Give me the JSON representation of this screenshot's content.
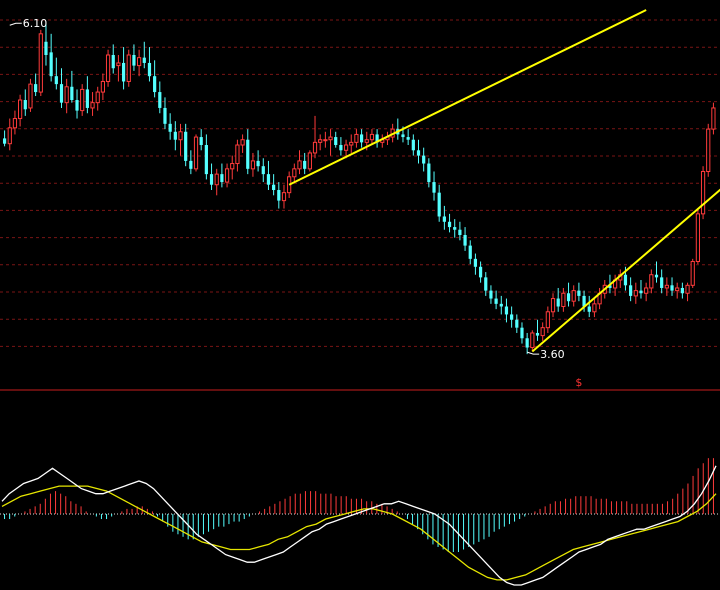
{
  "chart_data": [
    {
      "type": "candlestick",
      "ylim": [
        3.45,
        6.2
      ],
      "annotations": [
        {
          "text": "6.10",
          "index": 1,
          "value": 6.1
        },
        {
          "text": "3.60",
          "index": 101,
          "value": 3.6
        },
        {
          "text": "$",
          "index": 111,
          "value": null
        }
      ],
      "trend_lines": [
        {
          "from": [
            55,
            4.88
          ],
          "to": [
            124,
            6.2
          ]
        },
        {
          "from": [
            102,
            3.62
          ],
          "to": [
            143,
            5.0
          ]
        }
      ],
      "colors": {
        "up": "#ff3b3b",
        "down": "#54ffff",
        "trend": "#ffff00",
        "grid": "#7a1515",
        "separator": "#c81e1e",
        "annotation": "#ffffff",
        "marker": "#ff3333"
      },
      "candles": [
        [
          5.23,
          5.29,
          5.17,
          5.19
        ],
        [
          5.19,
          5.38,
          5.14,
          5.31
        ],
        [
          5.31,
          5.44,
          5.26,
          5.38
        ],
        [
          5.38,
          5.56,
          5.32,
          5.52
        ],
        [
          5.52,
          5.6,
          5.4,
          5.45
        ],
        [
          5.46,
          5.68,
          5.43,
          5.64
        ],
        [
          5.64,
          5.72,
          5.55,
          5.58
        ],
        [
          5.58,
          6.05,
          5.55,
          6.02
        ],
        [
          5.96,
          6.1,
          5.78,
          5.86
        ],
        [
          5.88,
          6.02,
          5.66,
          5.7
        ],
        [
          5.7,
          5.84,
          5.6,
          5.64
        ],
        [
          5.64,
          5.76,
          5.46,
          5.5
        ],
        [
          5.5,
          5.68,
          5.42,
          5.62
        ],
        [
          5.62,
          5.74,
          5.5,
          5.52
        ],
        [
          5.52,
          5.6,
          5.38,
          5.44
        ],
        [
          5.44,
          5.64,
          5.4,
          5.6
        ],
        [
          5.6,
          5.7,
          5.42,
          5.46
        ],
        [
          5.46,
          5.58,
          5.4,
          5.5
        ],
        [
          5.5,
          5.62,
          5.44,
          5.58
        ],
        [
          5.58,
          5.72,
          5.52,
          5.66
        ],
        [
          5.66,
          5.9,
          5.62,
          5.86
        ],
        [
          5.86,
          5.94,
          5.72,
          5.76
        ],
        [
          5.78,
          5.86,
          5.66,
          5.8
        ],
        [
          5.8,
          5.92,
          5.6,
          5.66
        ],
        [
          5.66,
          5.9,
          5.62,
          5.86
        ],
        [
          5.86,
          5.94,
          5.74,
          5.78
        ],
        [
          5.78,
          5.9,
          5.7,
          5.84
        ],
        [
          5.84,
          5.96,
          5.76,
          5.8
        ],
        [
          5.8,
          5.92,
          5.66,
          5.7
        ],
        [
          5.7,
          5.82,
          5.54,
          5.58
        ],
        [
          5.58,
          5.66,
          5.42,
          5.46
        ],
        [
          5.46,
          5.54,
          5.3,
          5.34
        ],
        [
          5.34,
          5.42,
          5.22,
          5.28
        ],
        [
          5.28,
          5.36,
          5.14,
          5.22
        ],
        [
          5.22,
          5.34,
          5.1,
          5.28
        ],
        [
          5.28,
          5.34,
          5.02,
          5.06
        ],
        [
          5.06,
          5.14,
          4.96,
          5.0
        ],
        [
          5.0,
          5.26,
          4.98,
          5.24
        ],
        [
          5.24,
          5.3,
          5.14,
          5.18
        ],
        [
          5.18,
          5.26,
          4.92,
          4.96
        ],
        [
          4.96,
          5.04,
          4.84,
          4.88
        ],
        [
          4.88,
          5.0,
          4.8,
          4.96
        ],
        [
          4.96,
          5.04,
          4.86,
          4.9
        ],
        [
          4.9,
          5.04,
          4.86,
          5.0
        ],
        [
          5.0,
          5.1,
          4.92,
          5.04
        ],
        [
          5.04,
          5.22,
          4.98,
          5.18
        ],
        [
          5.18,
          5.26,
          5.12,
          5.22
        ],
        [
          5.22,
          5.3,
          4.96,
          5.0
        ],
        [
          5.0,
          5.12,
          4.94,
          5.06
        ],
        [
          5.06,
          5.14,
          4.98,
          5.02
        ],
        [
          5.02,
          5.08,
          4.9,
          4.96
        ],
        [
          4.96,
          5.06,
          4.84,
          4.88
        ],
        [
          4.88,
          4.96,
          4.8,
          4.84
        ],
        [
          4.84,
          4.9,
          4.7,
          4.76
        ],
        [
          4.76,
          4.88,
          4.7,
          4.82
        ],
        [
          4.82,
          4.98,
          4.78,
          4.94
        ],
        [
          4.94,
          5.04,
          4.9,
          5.0
        ],
        [
          5.0,
          5.14,
          4.96,
          5.06
        ],
        [
          5.06,
          5.12,
          4.96,
          5.0
        ],
        [
          5.0,
          5.14,
          4.98,
          5.12
        ],
        [
          5.12,
          5.4,
          5.08,
          5.2
        ],
        [
          5.2,
          5.26,
          5.14,
          5.22
        ],
        [
          5.22,
          5.28,
          5.16,
          5.22
        ],
        [
          5.22,
          5.3,
          5.1,
          5.24
        ],
        [
          5.24,
          5.28,
          5.16,
          5.18
        ],
        [
          5.18,
          5.24,
          5.1,
          5.14
        ],
        [
          5.14,
          5.22,
          5.08,
          5.18
        ],
        [
          5.18,
          5.26,
          5.12,
          5.2
        ],
        [
          5.2,
          5.3,
          5.16,
          5.26
        ],
        [
          5.26,
          5.3,
          5.16,
          5.2
        ],
        [
          5.2,
          5.28,
          5.14,
          5.22
        ],
        [
          5.22,
          5.3,
          5.18,
          5.26
        ],
        [
          5.26,
          5.3,
          5.16,
          5.2
        ],
        [
          5.2,
          5.26,
          5.16,
          5.22
        ],
        [
          5.22,
          5.28,
          5.18,
          5.24
        ],
        [
          5.24,
          5.34,
          5.2,
          5.3
        ],
        [
          5.3,
          5.38,
          5.22,
          5.26
        ],
        [
          5.26,
          5.32,
          5.2,
          5.24
        ],
        [
          5.24,
          5.3,
          5.18,
          5.22
        ],
        [
          5.22,
          5.26,
          5.1,
          5.14
        ],
        [
          5.14,
          5.22,
          5.04,
          5.1
        ],
        [
          5.1,
          5.16,
          4.98,
          5.04
        ],
        [
          5.04,
          5.08,
          4.86,
          4.9
        ],
        [
          4.9,
          4.98,
          4.76,
          4.82
        ],
        [
          4.82,
          4.88,
          4.6,
          4.64
        ],
        [
          4.64,
          4.72,
          4.54,
          4.6
        ],
        [
          4.6,
          4.66,
          4.52,
          4.56
        ],
        [
          4.56,
          4.62,
          4.48,
          4.54
        ],
        [
          4.54,
          4.6,
          4.46,
          4.5
        ],
        [
          4.5,
          4.56,
          4.38,
          4.42
        ],
        [
          4.42,
          4.46,
          4.28,
          4.32
        ],
        [
          4.32,
          4.36,
          4.2,
          4.26
        ],
        [
          4.26,
          4.3,
          4.14,
          4.18
        ],
        [
          4.18,
          4.22,
          4.04,
          4.08
        ],
        [
          4.08,
          4.12,
          3.98,
          4.02
        ],
        [
          4.02,
          4.08,
          3.94,
          3.98
        ],
        [
          3.98,
          4.04,
          3.9,
          3.96
        ],
        [
          3.96,
          4.02,
          3.84,
          3.9
        ],
        [
          3.9,
          3.96,
          3.8,
          3.86
        ],
        [
          3.86,
          3.9,
          3.76,
          3.8
        ],
        [
          3.8,
          3.84,
          3.68,
          3.72
        ],
        [
          3.72,
          3.76,
          3.6,
          3.65
        ],
        [
          3.65,
          3.78,
          3.62,
          3.76
        ],
        [
          3.76,
          3.86,
          3.7,
          3.74
        ],
        [
          3.74,
          3.84,
          3.7,
          3.8
        ],
        [
          3.8,
          3.96,
          3.76,
          3.92
        ],
        [
          3.92,
          4.06,
          3.88,
          4.02
        ],
        [
          4.02,
          4.1,
          3.92,
          3.96
        ],
        [
          3.96,
          4.1,
          3.92,
          4.06
        ],
        [
          4.06,
          4.14,
          3.96,
          4.0
        ],
        [
          4.0,
          4.12,
          3.96,
          4.08
        ],
        [
          4.08,
          4.14,
          4.0,
          4.04
        ],
        [
          4.04,
          4.08,
          3.92,
          3.96
        ],
        [
          3.96,
          4.04,
          3.88,
          3.92
        ],
        [
          3.92,
          4.02,
          3.88,
          3.98
        ],
        [
          3.98,
          4.1,
          3.94,
          4.06
        ],
        [
          4.06,
          4.16,
          4.02,
          4.12
        ],
        [
          4.12,
          4.2,
          4.06,
          4.1
        ],
        [
          4.1,
          4.2,
          4.04,
          4.16
        ],
        [
          4.16,
          4.24,
          4.1,
          4.2
        ],
        [
          4.2,
          4.26,
          4.08,
          4.12
        ],
        [
          4.12,
          4.18,
          4.0,
          4.04
        ],
        [
          4.04,
          4.14,
          3.98,
          4.08
        ],
        [
          4.08,
          4.16,
          4.02,
          4.06
        ],
        [
          4.06,
          4.14,
          4.0,
          4.1
        ],
        [
          4.1,
          4.24,
          4.06,
          4.2
        ],
        [
          4.2,
          4.3,
          4.14,
          4.18
        ],
        [
          4.18,
          4.24,
          4.06,
          4.1
        ],
        [
          4.1,
          4.18,
          4.04,
          4.12
        ],
        [
          4.12,
          4.18,
          4.04,
          4.08
        ],
        [
          4.08,
          4.14,
          4.02,
          4.1
        ],
        [
          4.1,
          4.14,
          4.02,
          4.06
        ],
        [
          4.06,
          4.14,
          4.0,
          4.12
        ],
        [
          4.12,
          4.32,
          4.1,
          4.3
        ],
        [
          4.3,
          4.7,
          4.28,
          4.66
        ],
        [
          4.66,
          5.02,
          4.62,
          4.98
        ],
        [
          4.98,
          5.34,
          4.94,
          5.3
        ],
        [
          5.3,
          5.5,
          5.26,
          5.46
        ]
      ]
    },
    {
      "type": "macd",
      "ylim": [
        -0.28,
        0.26
      ],
      "colors": {
        "dif": "#ffffff",
        "dea": "#e6e600",
        "hist_up": "#ff3b3b",
        "hist_down": "#54ffff",
        "zero": "#e0e0e0"
      },
      "histogram": [
        -0.02,
        -0.02,
        -0.01,
        0.0,
        0.01,
        0.02,
        0.03,
        0.04,
        0.06,
        0.08,
        0.09,
        0.08,
        0.07,
        0.05,
        0.04,
        0.03,
        0.01,
        0.0,
        -0.01,
        -0.02,
        -0.02,
        -0.01,
        0.0,
        0.01,
        0.02,
        0.02,
        0.03,
        0.03,
        0.02,
        0.01,
        -0.01,
        -0.03,
        -0.05,
        -0.07,
        -0.08,
        -0.09,
        -0.1,
        -0.1,
        -0.09,
        -0.08,
        -0.07,
        -0.06,
        -0.05,
        -0.05,
        -0.04,
        -0.03,
        -0.03,
        -0.02,
        -0.01,
        0.0,
        0.01,
        0.02,
        0.03,
        0.04,
        0.05,
        0.06,
        0.07,
        0.08,
        0.08,
        0.09,
        0.09,
        0.09,
        0.08,
        0.08,
        0.08,
        0.07,
        0.07,
        0.07,
        0.06,
        0.06,
        0.06,
        0.05,
        0.05,
        0.04,
        0.04,
        0.03,
        0.02,
        0.01,
        0.0,
        -0.02,
        -0.04,
        -0.06,
        -0.08,
        -0.1,
        -0.12,
        -0.13,
        -0.14,
        -0.15,
        -0.15,
        -0.15,
        -0.14,
        -0.13,
        -0.12,
        -0.11,
        -0.1,
        -0.09,
        -0.07,
        -0.06,
        -0.05,
        -0.04,
        -0.03,
        -0.02,
        -0.01,
        0.0,
        0.01,
        0.02,
        0.03,
        0.04,
        0.05,
        0.05,
        0.06,
        0.06,
        0.07,
        0.07,
        0.07,
        0.07,
        0.06,
        0.06,
        0.06,
        0.05,
        0.05,
        0.05,
        0.05,
        0.04,
        0.04,
        0.04,
        0.04,
        0.04,
        0.04,
        0.04,
        0.05,
        0.06,
        0.08,
        0.1,
        0.12,
        0.15,
        0.18,
        0.2,
        0.22,
        0.22
      ],
      "dif": [
        0.05,
        0.08,
        0.1,
        0.12,
        0.13,
        0.14,
        0.16,
        0.18,
        0.16,
        0.14,
        0.12,
        0.1,
        0.09,
        0.08,
        0.08,
        0.09,
        0.1,
        0.11,
        0.12,
        0.13,
        0.12,
        0.1,
        0.07,
        0.04,
        0.01,
        -0.02,
        -0.05,
        -0.08,
        -0.1,
        -0.12,
        -0.14,
        -0.16,
        -0.17,
        -0.18,
        -0.19,
        -0.19,
        -0.18,
        -0.17,
        -0.16,
        -0.15,
        -0.13,
        -0.11,
        -0.09,
        -0.07,
        -0.06,
        -0.04,
        -0.03,
        -0.02,
        -0.01,
        0.0,
        0.01,
        0.02,
        0.03,
        0.04,
        0.04,
        0.05,
        0.04,
        0.03,
        0.02,
        0.01,
        0.0,
        -0.02,
        -0.04,
        -0.07,
        -0.1,
        -0.13,
        -0.16,
        -0.19,
        -0.22,
        -0.25,
        -0.27,
        -0.28,
        -0.28,
        -0.27,
        -0.26,
        -0.25,
        -0.23,
        -0.21,
        -0.19,
        -0.17,
        -0.15,
        -0.14,
        -0.13,
        -0.12,
        -0.1,
        -0.09,
        -0.08,
        -0.07,
        -0.06,
        -0.06,
        -0.05,
        -0.04,
        -0.03,
        -0.02,
        -0.01,
        0.01,
        0.04,
        0.08,
        0.13,
        0.19
      ],
      "dea": [
        0.03,
        0.05,
        0.07,
        0.08,
        0.09,
        0.1,
        0.11,
        0.11,
        0.11,
        0.11,
        0.1,
        0.09,
        0.07,
        0.05,
        0.03,
        0.01,
        -0.01,
        -0.03,
        -0.05,
        -0.07,
        -0.09,
        -0.11,
        -0.12,
        -0.13,
        -0.14,
        -0.14,
        -0.14,
        -0.13,
        -0.12,
        -0.1,
        -0.09,
        -0.07,
        -0.05,
        -0.04,
        -0.02,
        -0.01,
        0.0,
        0.01,
        0.02,
        0.02,
        0.01,
        0.0,
        -0.02,
        -0.04,
        -0.06,
        -0.09,
        -0.12,
        -0.15,
        -0.18,
        -0.21,
        -0.23,
        -0.25,
        -0.26,
        -0.26,
        -0.25,
        -0.24,
        -0.22,
        -0.2,
        -0.18,
        -0.16,
        -0.14,
        -0.13,
        -0.12,
        -0.11,
        -0.1,
        -0.09,
        -0.08,
        -0.07,
        -0.06,
        -0.05,
        -0.04,
        -0.03,
        -0.01,
        0.01,
        0.04,
        0.08
      ]
    }
  ]
}
